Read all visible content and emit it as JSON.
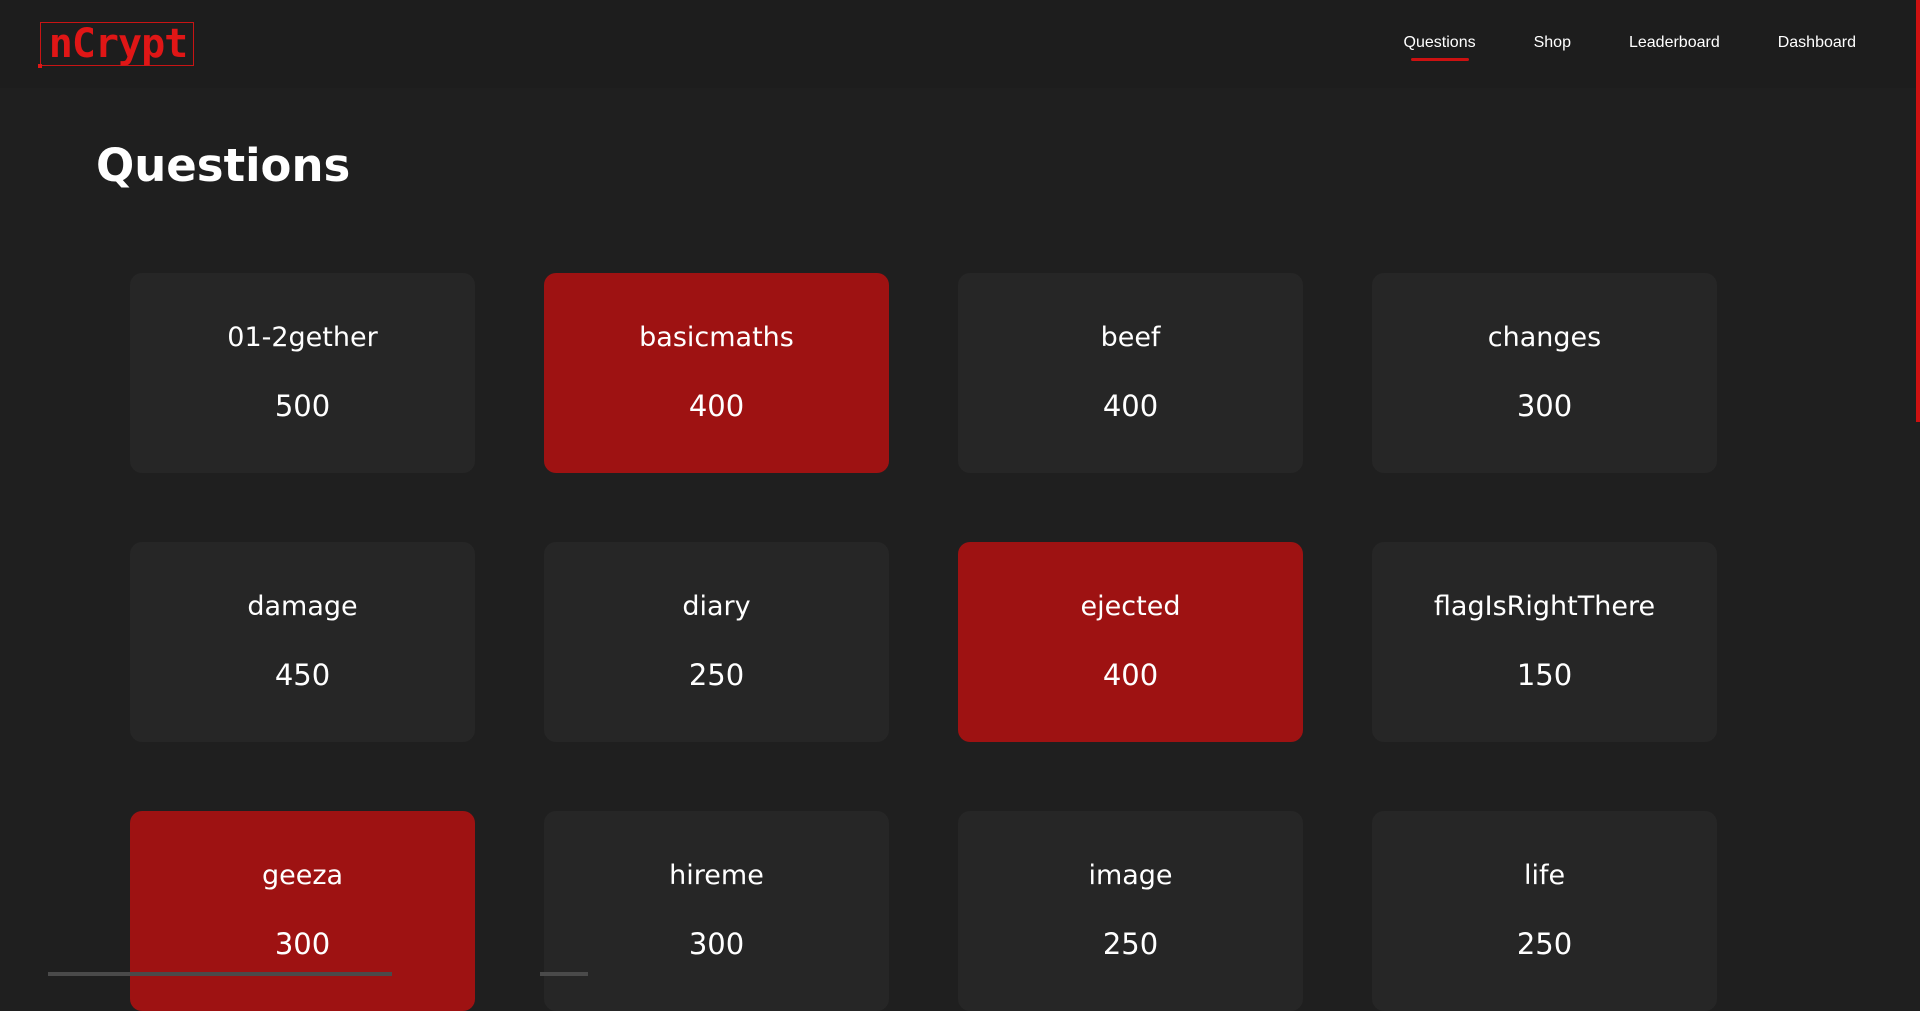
{
  "brand": {
    "logo_text": "nCrypt"
  },
  "nav": {
    "items": [
      {
        "label": "Questions",
        "active": true
      },
      {
        "label": "Shop",
        "active": false
      },
      {
        "label": "Leaderboard",
        "active": false
      },
      {
        "label": "Dashboard",
        "active": false
      }
    ]
  },
  "page": {
    "title": "Questions"
  },
  "questions": [
    {
      "name": "01-2gether",
      "points": "500",
      "solved": false
    },
    {
      "name": "basicmaths",
      "points": "400",
      "solved": true
    },
    {
      "name": "beef",
      "points": "400",
      "solved": false
    },
    {
      "name": "changes",
      "points": "300",
      "solved": false
    },
    {
      "name": "damage",
      "points": "450",
      "solved": false
    },
    {
      "name": "diary",
      "points": "250",
      "solved": false
    },
    {
      "name": "ejected",
      "points": "400",
      "solved": true
    },
    {
      "name": "flagIsRightThere",
      "points": "150",
      "solved": false
    },
    {
      "name": "geeza",
      "points": "300",
      "solved": true
    },
    {
      "name": "hireme",
      "points": "300",
      "solved": false
    },
    {
      "name": "image",
      "points": "250",
      "solved": false
    },
    {
      "name": "life",
      "points": "250",
      "solved": false
    }
  ],
  "colors": {
    "background": "#1f1f1f",
    "card": "#262626",
    "card_solved": "#9e1212",
    "accent": "#cc1111"
  }
}
